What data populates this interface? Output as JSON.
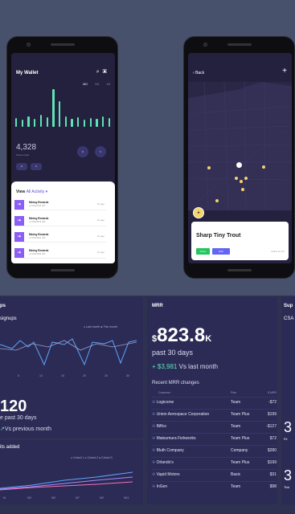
{
  "wallet": {
    "title": "My Wallet",
    "tabs": [
      "MO",
      "1W",
      "1M"
    ],
    "bars": [
      10,
      8,
      12,
      9,
      14,
      11,
      44,
      30,
      12,
      9,
      11,
      8,
      10,
      9,
      12,
      10
    ],
    "value": "4,328",
    "value_caption": "Tokens held",
    "circles": [
      "R",
      "S"
    ],
    "pills": [
      "R",
      "S"
    ],
    "activity_header": "View",
    "activity_link": "All Activity",
    "activities": [
      {
        "title": "Mining Rewards",
        "sub": "+0.00012345 LBT",
        "age": "1h ago"
      },
      {
        "title": "Mining Rewards",
        "sub": "+0.00018876 LBT",
        "age": "1h ago"
      },
      {
        "title": "Mining Rewards",
        "sub": "+0.00023001 LBT",
        "age": "1h ago"
      },
      {
        "title": "Mining Rewards",
        "sub": "+0.00010054 LBT",
        "age": "1h ago"
      }
    ]
  },
  "map_phone": {
    "back_label": "Back",
    "plus_label": "+",
    "card_name": "Sharp Tiny Trout",
    "btn_green": "Active",
    "btn_blue": "Edit",
    "card_small": "Online for 4m"
  },
  "mrr": {
    "title": "MRR",
    "currency": "$",
    "amount": "823.8",
    "suffix": "K",
    "period": "past 30 days",
    "delta": "+ $3,981",
    "delta_text": "Vs last month",
    "changes_title": "Recent MRR changes",
    "headers": [
      "Customer",
      "Plan",
      "$ MRR"
    ],
    "rows": [
      {
        "customer": "Logicome",
        "plan": "Team",
        "value": "-$72"
      },
      {
        "customer": "Union Aerospace Corporation",
        "plan": "Team Plus",
        "value": "$199"
      },
      {
        "customer": "Biffco",
        "plan": "Team",
        "value": "-$127"
      },
      {
        "customer": "Matsumura Fishworks",
        "plan": "Team Plus",
        "value": "$72"
      },
      {
        "customer": "Bluth Company",
        "plan": "Company",
        "value": "$280"
      },
      {
        "customer": "Orlando's",
        "plan": "Team Plus",
        "value": "$199"
      },
      {
        "customer": "Vapid Motors",
        "plan": "Basic",
        "value": "$31"
      },
      {
        "customer": "InGen",
        "plan": "Team",
        "value": "$98"
      }
    ]
  },
  "signups": {
    "title": "ps",
    "subtitle": "signups",
    "legend": [
      "Last month",
      "This month"
    ],
    "ticks": [
      "5",
      "10",
      "15",
      "20",
      "25",
      "30"
    ],
    "big": "120",
    "period": "e past 30 days",
    "vs": "Vs previous month"
  },
  "cohorts": {
    "title": "its added",
    "legend": [
      "Cohort 1",
      "Cohort 2",
      "Cohort 3"
    ],
    "ticks": [
      "M",
      "M3",
      "M5",
      "M7",
      "M9",
      "M11"
    ]
  },
  "right_col": {
    "title": "Sup",
    "sub": "CSA",
    "n1": "3",
    "n1_label": "Fir",
    "n2": "3",
    "n2_label": "Tick"
  }
}
